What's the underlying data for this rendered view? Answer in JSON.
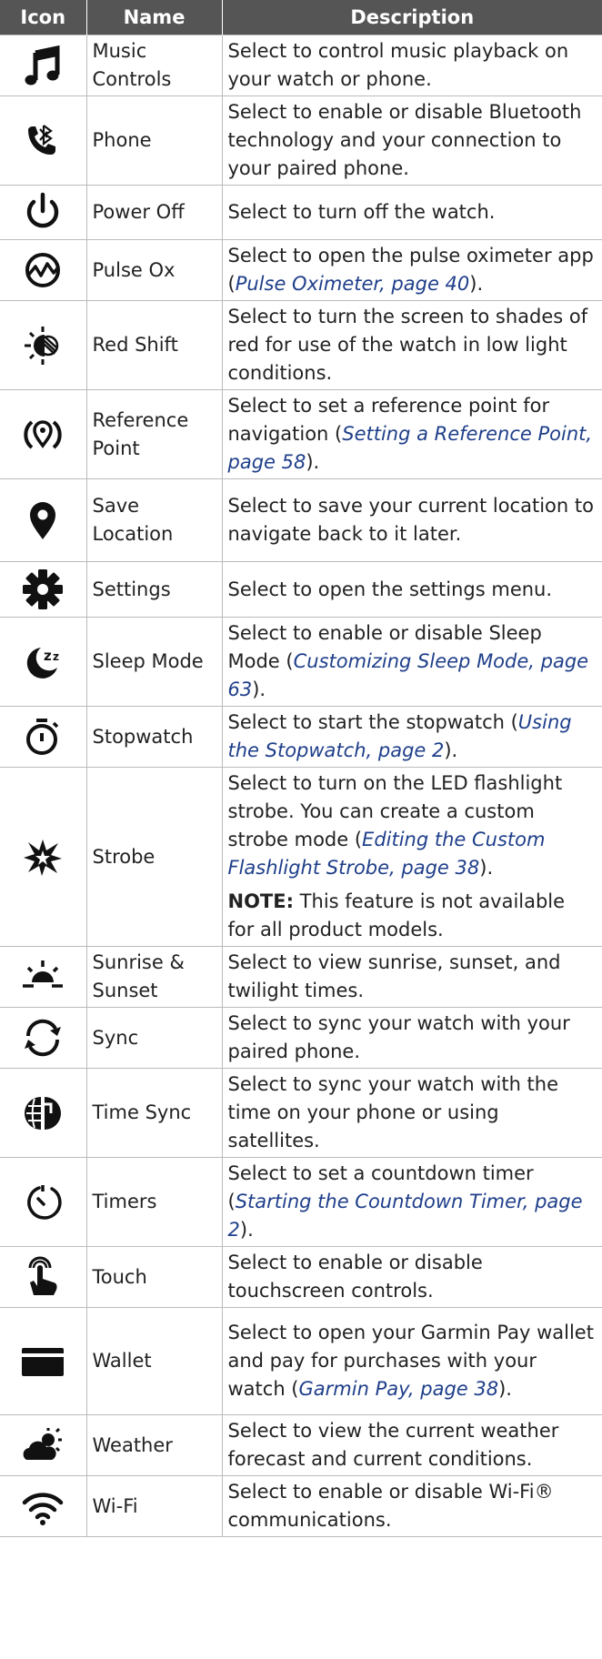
{
  "headers": {
    "icon": "Icon",
    "name": "Name",
    "description": "Description"
  },
  "rows": [
    {
      "icon": "music-note-icon",
      "name": "Music Controls",
      "desc_pre": "Select to control music playback on your watch or phone.",
      "link": "",
      "desc_post": ""
    },
    {
      "icon": "phone-bluetooth-icon",
      "name": "Phone",
      "desc_pre": "Select to enable or disable Bluetooth technology and your connection to your paired phone.",
      "link": "",
      "desc_post": ""
    },
    {
      "icon": "power-icon",
      "name": "Power Off",
      "desc_pre": "Select to turn off the watch.",
      "link": "",
      "desc_post": ""
    },
    {
      "icon": "pulse-ox-icon",
      "name": "Pulse Ox",
      "desc_pre": "Select to open the pulse oximeter app (",
      "link": "Pulse Oximeter, page 40",
      "desc_post": ")."
    },
    {
      "icon": "red-shift-icon",
      "name": "Red Shift",
      "desc_pre": "Select to turn the screen to shades of red for use of the watch in low light conditions.",
      "link": "",
      "desc_post": ""
    },
    {
      "icon": "reference-point-icon",
      "name": "Reference Point",
      "desc_pre": "Select to set a reference point for navigation (",
      "link": "Setting a Reference Point, page 58",
      "desc_post": ")."
    },
    {
      "icon": "location-pin-icon",
      "name": "Save Location",
      "desc_pre": "Select to save your current location to navigate back to it later.",
      "link": "",
      "desc_post": ""
    },
    {
      "icon": "gear-icon",
      "name": "Settings",
      "desc_pre": "Select to open the settings menu.",
      "link": "",
      "desc_post": ""
    },
    {
      "icon": "sleep-mode-icon",
      "name": "Sleep Mode",
      "desc_pre": "Select to enable or disable Sleep Mode (",
      "link": "Customizing Sleep Mode, page 63",
      "desc_post": ")."
    },
    {
      "icon": "stopwatch-icon",
      "name": "Stopwatch",
      "desc_pre": "Select to start the stopwatch (",
      "link": "Using the Stopwatch, page 2",
      "desc_post": ")."
    },
    {
      "icon": "strobe-icon",
      "name": "Strobe",
      "desc_pre": "Select to turn on the LED flashlight strobe. You can create a custom strobe mode (",
      "link": "Editing the Custom Flashlight Strobe, page 38",
      "desc_post": ").",
      "note_label": "NOTE:",
      "note_text": " This feature is not available for all product models."
    },
    {
      "icon": "sunrise-icon",
      "name": "Sunrise & Sunset",
      "desc_pre": "Select to view sunrise, sunset, and twilight times.",
      "link": "",
      "desc_post": ""
    },
    {
      "icon": "sync-icon",
      "name": "Sync",
      "desc_pre": "Select to sync your watch with your paired phone.",
      "link": "",
      "desc_post": ""
    },
    {
      "icon": "time-sync-icon",
      "name": "Time Sync",
      "desc_pre": "Select to sync your watch with the time on your phone or using satellites.",
      "link": "",
      "desc_post": ""
    },
    {
      "icon": "timer-icon",
      "name": "Timers",
      "desc_pre": "Select to set a countdown timer (",
      "link": "Starting the Countdown Timer, page 2",
      "desc_post": ")."
    },
    {
      "icon": "touch-icon",
      "name": "Touch",
      "desc_pre": "Select to enable or disable touchscreen controls.",
      "link": "",
      "desc_post": ""
    },
    {
      "icon": "wallet-icon",
      "name": "Wallet",
      "desc_pre": "Select to open your Garmin Pay wallet and pay for purchases with your watch (",
      "link": "Garmin Pay, page 38",
      "desc_post": ")."
    },
    {
      "icon": "weather-icon",
      "name": "Weather",
      "desc_pre": "Select to view the current weather forecast and current conditions.",
      "link": "",
      "desc_post": ""
    },
    {
      "icon": "wifi-icon",
      "name": "Wi-Fi",
      "desc_pre": "Select to enable or disable Wi-Fi® communications.",
      "link": "",
      "desc_post": ""
    }
  ]
}
